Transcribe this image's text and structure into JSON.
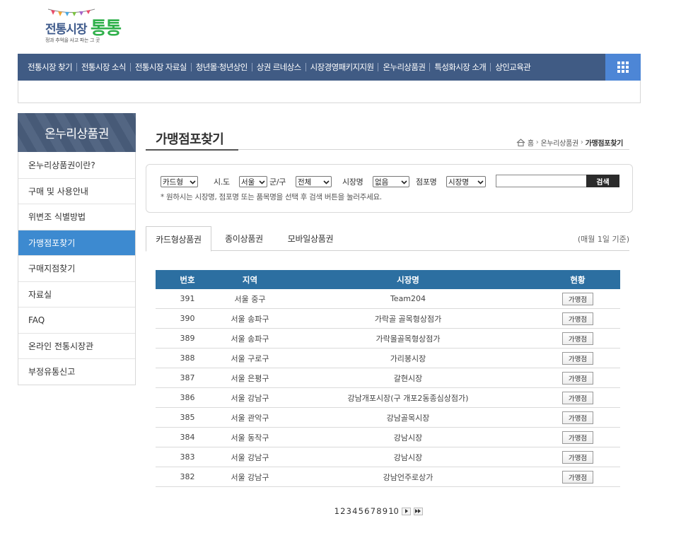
{
  "logo": {
    "name_part1": "전통시장",
    "name_part2": "통통",
    "slogan": "정과 추억을 사고 파는 그 곳"
  },
  "gnb": {
    "items": [
      "전통시장 찾기",
      "전통시장 소식",
      "전통시장 자료실",
      "청년몰·청년상인",
      "상권 르네상스",
      "시장경영패키지지원",
      "온누리상품권",
      "특성화시장 소개",
      "상인교육관"
    ]
  },
  "lnb": {
    "title": "온누리상품권",
    "items": [
      "온누리상품권이란?",
      "구매 및 사용안내",
      "위변조 식별방법",
      "가맹점포찾기",
      "구매지점찾기",
      "자료실",
      "FAQ",
      "온라인 전통시장관",
      "부정유통신고"
    ]
  },
  "page": {
    "title": "가맹점포찾기",
    "breadcrumb": [
      "홈",
      "온누리상품권",
      "가맹점포찾기"
    ]
  },
  "search": {
    "type_select": "카드형",
    "sido_label": "시.도",
    "sido_select": "서울",
    "gugun_label": "군/구",
    "gugun_select": "전체",
    "market_label": "시장명",
    "market_select": "없음",
    "store_label": "점포명",
    "store_select": "시장명",
    "button": "검색",
    "hint": "* 원하시는 시장명, 점포명 또는 품목명을 선택 후 검색 버튼을 눌러주세요."
  },
  "tabs": {
    "items": [
      "카드형상품권",
      "종이상품권",
      "모바일상품권"
    ],
    "basis": "(매월 1일 기준)"
  },
  "table": {
    "headers": [
      "번호",
      "지역",
      "시장명",
      "현황"
    ],
    "rows": [
      {
        "no": "391",
        "region": "서울 중구",
        "market": "Team204",
        "status": "가맹점"
      },
      {
        "no": "390",
        "region": "서울 송파구",
        "market": "가락골 골목형상점가",
        "status": "가맹점"
      },
      {
        "no": "389",
        "region": "서울 송파구",
        "market": "가락몰골목형상점가",
        "status": "가맹점"
      },
      {
        "no": "388",
        "region": "서울 구로구",
        "market": "가리봉시장",
        "status": "가맹점"
      },
      {
        "no": "387",
        "region": "서울 은평구",
        "market": "갈현시장",
        "status": "가맹점"
      },
      {
        "no": "386",
        "region": "서울 강남구",
        "market": "강남개포시장(구 개포2동종심상점가)",
        "status": "가맹점"
      },
      {
        "no": "385",
        "region": "서울 관악구",
        "market": "강남골목시장",
        "status": "가맹점"
      },
      {
        "no": "384",
        "region": "서울 동작구",
        "market": "강남시장",
        "status": "가맹점"
      },
      {
        "no": "383",
        "region": "서울 강남구",
        "market": "강남시장",
        "status": "가맹점"
      },
      {
        "no": "382",
        "region": "서울 강남구",
        "market": "강남언주로상가",
        "status": "가맹점"
      }
    ]
  },
  "pagination": {
    "pages": [
      "1",
      "2",
      "3",
      "4",
      "5",
      "6",
      "7",
      "8",
      "9",
      "10"
    ],
    "next_icon": "next-icon",
    "last_icon": "last-icon"
  },
  "colors": {
    "gnb_bg": "#405b84",
    "lnb_active": "#3d8ad0",
    "table_header": "#2c6fa1",
    "logo_green": "#2fb04a"
  }
}
